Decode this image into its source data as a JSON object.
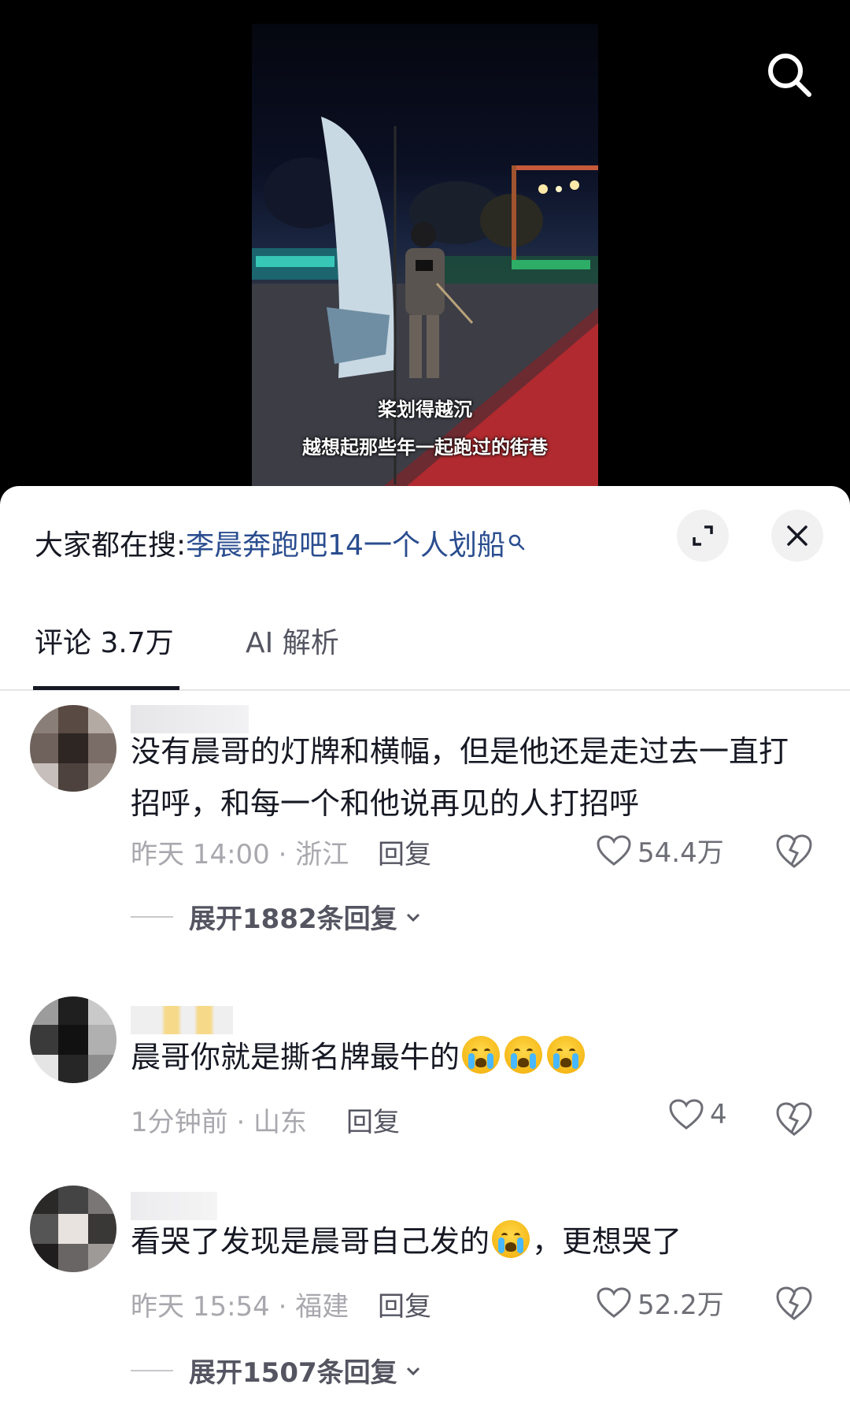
{
  "video": {
    "subtitle_line1": "桨划得越沉",
    "subtitle_line2": "越想起那些年一起跑过的街巷"
  },
  "top_bar": {
    "search_icon": "search-icon"
  },
  "sheet": {
    "search_hint": {
      "prefix": "大家都在搜:",
      "query": "李晨奔跑吧14一个人划船",
      "icon": "search-small-icon"
    },
    "expand_icon": "expand-icon",
    "close_icon": "close-icon",
    "tabs": [
      {
        "label": "评论 3.7万",
        "active": true
      },
      {
        "label": "AI 解析",
        "active": false
      }
    ]
  },
  "comments": [
    {
      "text": "没有晨哥的灯牌和横幅，但是他还是走过去一直打招呼，和每一个和他说再见的人打招呼",
      "meta": "昨天 14:00 · 浙江",
      "reply_label": "回复",
      "likes": "54.4万",
      "expand_label": "展开1882条回复"
    },
    {
      "text": "晨哥你就是撕名牌最牛的",
      "emoji_count": 3,
      "meta": "1分钟前 · 山东",
      "reply_label": "回复",
      "likes": "4"
    },
    {
      "text_before": "看哭了发现是晨哥自己发的",
      "text_after": "，更想哭了",
      "meta": "昨天 15:54 · 福建",
      "reply_label": "回复",
      "likes": "52.2万",
      "expand_label": "展开1507条回复"
    }
  ],
  "colors": {
    "accent_link": "#2a4d8f",
    "text_primary": "#161823",
    "text_secondary": "#a8a8ae"
  }
}
